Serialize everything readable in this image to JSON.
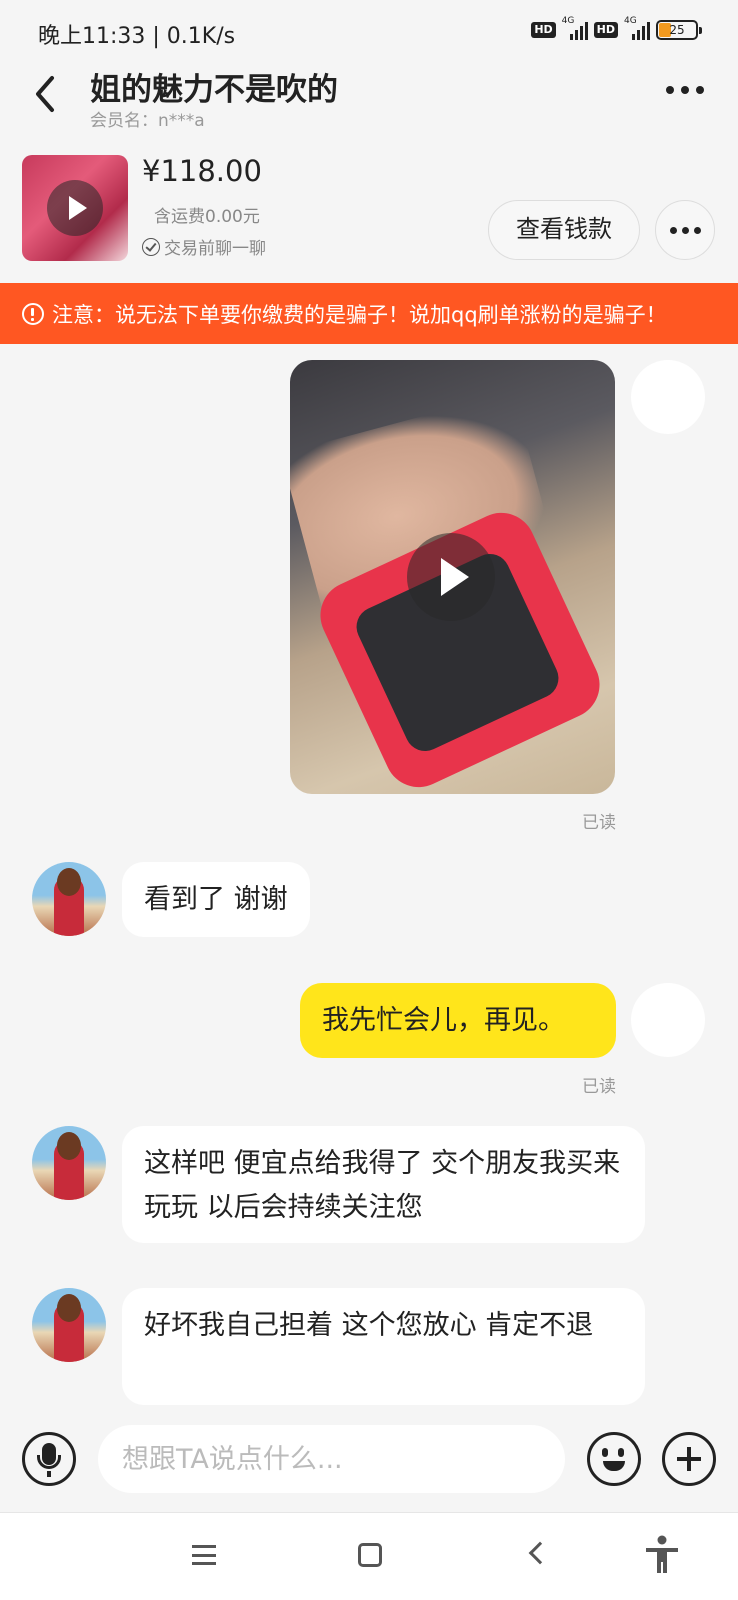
{
  "status_bar": {
    "time": "晚上11:33 | 0.1K/s",
    "hd1": "HD",
    "net1": "4G",
    "hd2": "HD",
    "net2": "4G",
    "battery": "25"
  },
  "header": {
    "title": "姐的魅力不是吹的",
    "subtitle": "会员名：n***a"
  },
  "product": {
    "price": "¥118.00",
    "shipping": "含运费0.00元",
    "chat_hint": "交易前聊一聊",
    "view_button": "查看钱款"
  },
  "warning": {
    "text": "注意：说无法下单要你缴费的是骗子！说加qq刷单涨粉的是骗子！"
  },
  "messages": {
    "read_label_1": "已读",
    "other_1": "看到了 谢谢",
    "self_1": "我先忙会儿，再见。",
    "read_label_2": "已读",
    "other_2": "这样吧 便宜点给我得了 交个朋友我买来玩玩 以后会持续关注您",
    "other_3": "好坏我自己担着 这个您放心 肯定不退"
  },
  "input": {
    "placeholder": "想跟TA说点什么..."
  },
  "colors": {
    "warning_bg": "#ff5722",
    "self_bubble": "#ffe51b",
    "other_bubble": "#ffffff",
    "background": "#f5f5f5"
  },
  "icons": [
    "back-icon",
    "more-icon",
    "play-icon",
    "check-circle-icon",
    "warning-icon",
    "microphone-icon",
    "emoji-icon",
    "plus-icon",
    "menu-icon",
    "home-icon",
    "nav-back-icon",
    "accessibility-icon"
  ]
}
